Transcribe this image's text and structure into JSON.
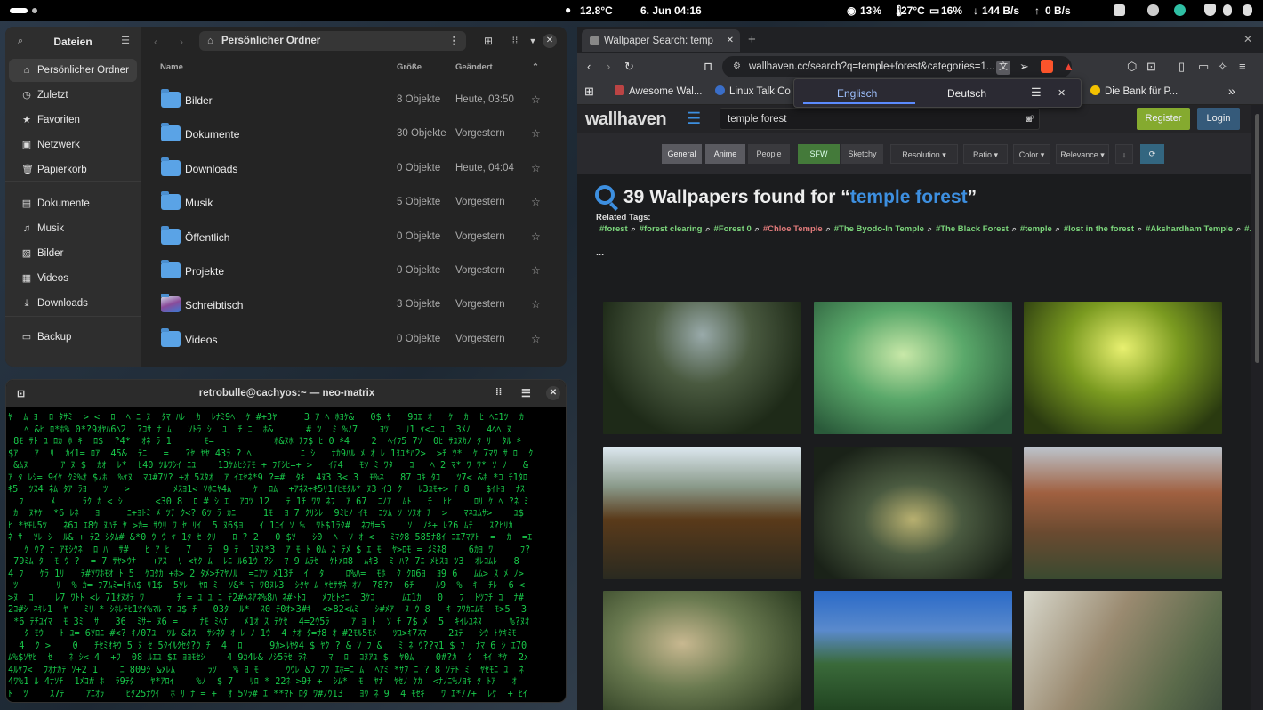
{
  "topbar": {
    "weather": "12.8°C",
    "datetime": "6. Jun  04:16",
    "cpu": "13%",
    "temp": "27°C",
    "mem": "16%",
    "net_down": "144 B/s",
    "net_up": "0 B/s"
  },
  "files": {
    "title": "Dateien",
    "path": "Persönlicher Ordner",
    "sidebar": [
      {
        "label": "Persönlicher Ordner",
        "icon": "home-icon",
        "glyph": "⌂"
      },
      {
        "label": "Zuletzt",
        "icon": "clock-icon",
        "glyph": "◷"
      },
      {
        "label": "Favoriten",
        "icon": "star-icon",
        "glyph": "★"
      },
      {
        "label": "Netzwerk",
        "icon": "network-icon",
        "glyph": "▣"
      },
      {
        "label": "Papierkorb",
        "icon": "trash-icon",
        "glyph": "🗑"
      },
      {
        "label": "Dokumente",
        "icon": "document-icon",
        "glyph": "▤"
      },
      {
        "label": "Musik",
        "icon": "music-icon",
        "glyph": "♫"
      },
      {
        "label": "Bilder",
        "icon": "image-icon",
        "glyph": "▨"
      },
      {
        "label": "Videos",
        "icon": "video-icon",
        "glyph": "▦"
      },
      {
        "label": "Downloads",
        "icon": "download-icon",
        "glyph": "⤓"
      },
      {
        "label": "Backup",
        "icon": "drive-icon",
        "glyph": "▭"
      }
    ],
    "columns": {
      "name": "Name",
      "size": "Größe",
      "modified": "Geändert"
    },
    "rows": [
      {
        "name": "Bilder",
        "size": "8 Objekte",
        "date": "Heute, 03:50"
      },
      {
        "name": "Dokumente",
        "size": "30 Objekte",
        "date": "Vorgestern"
      },
      {
        "name": "Downloads",
        "size": "0 Objekte",
        "date": "Heute, 04:04"
      },
      {
        "name": "Musik",
        "size": "5 Objekte",
        "date": "Vorgestern"
      },
      {
        "name": "Öffentlich",
        "size": "0 Objekte",
        "date": "Vorgestern"
      },
      {
        "name": "Projekte",
        "size": "0 Objekte",
        "date": "Vorgestern"
      },
      {
        "name": "Schreibtisch",
        "size": "3 Objekte",
        "date": "Vorgestern"
      },
      {
        "name": "Videos",
        "size": "0 Objekte",
        "date": "Vorgestern"
      }
    ]
  },
  "terminal": {
    "title": "retrobulle@cachyos:~ — neo-matrix"
  },
  "browser": {
    "tab_title": "Wallpaper Search: temp",
    "url": "wallhaven.cc/search?q=temple+forest&categories=1...",
    "bookmarks": [
      "Awesome Wal...",
      "Linux Talk Co",
      "Die Bank für P..."
    ],
    "translate": {
      "from": "Englisch",
      "to": "Deutsch"
    },
    "site": {
      "logo": "wallhaven",
      "search_value": "temple forest",
      "register": "Register",
      "login": "Login",
      "filters": {
        "general": "General",
        "anime": "Anime",
        "people": "People",
        "sfw": "SFW",
        "sketchy": "Sketchy",
        "resolution": "Resolution ▾",
        "ratio": "Ratio ▾",
        "color": "Color ▾",
        "relevance": "Relevance ▾",
        "order": "↓",
        "refresh": "⟳"
      },
      "results_prefix": "39 Wallpapers found for “",
      "results_query": "temple forest",
      "results_suffix": "”",
      "related_label": "Related Tags:",
      "tags": [
        {
          "t": "#forest",
          "c": "g"
        },
        {
          "t": "#forest clearing",
          "c": "g"
        },
        {
          "t": "#Forest 0",
          "c": "g"
        },
        {
          "t": "#Chloe Temple",
          "c": "r"
        },
        {
          "t": "#The Byodo-In Temple",
          "c": "g"
        },
        {
          "t": "#The Black Forest",
          "c": "g"
        },
        {
          "t": "#temple",
          "c": "g"
        },
        {
          "t": "#lost in the forest",
          "c": "g"
        },
        {
          "t": "#Akshardham Temple",
          "c": "g"
        },
        {
          "t": "#Juno Temple",
          "c": "g"
        }
      ],
      "more": "..."
    }
  }
}
